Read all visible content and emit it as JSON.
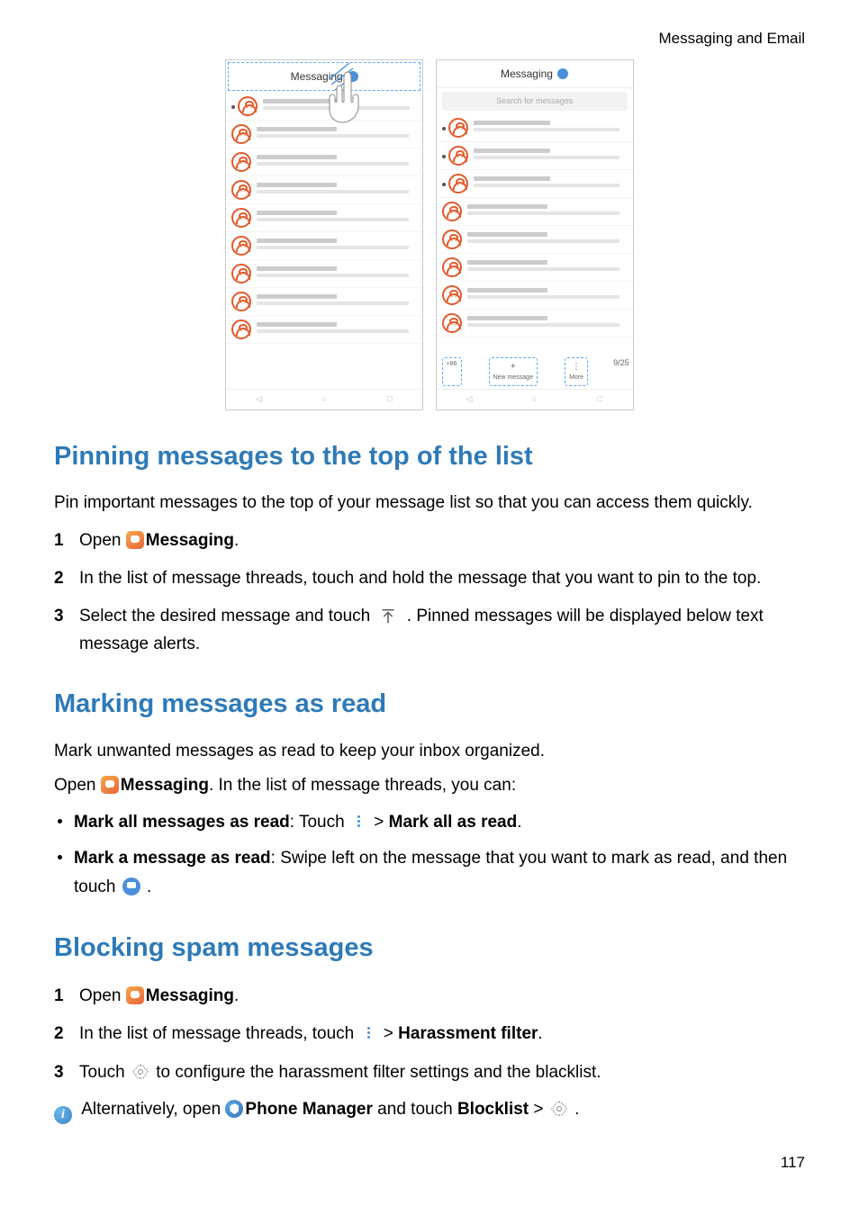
{
  "header": {
    "breadcrumb": "Messaging and Email"
  },
  "screenshot": {
    "app_title": "Messaging",
    "search_placeholder": "Search for messages",
    "add_label": "+86",
    "new_message_label": "New message",
    "more_label": "More",
    "selection_counter": "9/25"
  },
  "s1": {
    "heading": "Pinning messages to the top of the list",
    "intro": "Pin important messages to the top of your message list so that you can access them quickly.",
    "step1_a": "Open ",
    "step1_b": "Messaging",
    "step1_c": ".",
    "step2": "In the list of message threads, touch and hold the message that you want to pin to the top.",
    "step3_a": "Select the desired message and touch ",
    "step3_b": " . Pinned messages will be displayed below text message alerts."
  },
  "s2": {
    "heading": "Marking messages as read",
    "intro": "Mark unwanted messages as read to keep your inbox organized.",
    "open_a": "Open ",
    "open_b": "Messaging",
    "open_c": ". In the list of message threads, you can:",
    "b1_a": "Mark all messages as read",
    "b1_b": ": Touch ",
    "b1_c": " > ",
    "b1_d": "Mark all as read",
    "b1_e": ".",
    "b2_a": "Mark a message as read",
    "b2_b": ": Swipe left on the message that you want to mark as read, and then touch ",
    "b2_c": " ."
  },
  "s3": {
    "heading": "Blocking spam messages",
    "step1_a": "Open ",
    "step1_b": "Messaging",
    "step1_c": ".",
    "step2_a": "In the list of message threads, touch ",
    "step2_b": " > ",
    "step2_c": "Harassment filter",
    "step2_d": ".",
    "step3_a": "Touch ",
    "step3_b": " to configure the harassment filter settings and the blacklist.",
    "note_a": "Alternatively, open ",
    "note_b": "Phone Manager",
    "note_c": " and touch ",
    "note_d": "Blocklist",
    "note_e": " > ",
    "note_f": " ."
  },
  "footer": {
    "page": "117"
  }
}
